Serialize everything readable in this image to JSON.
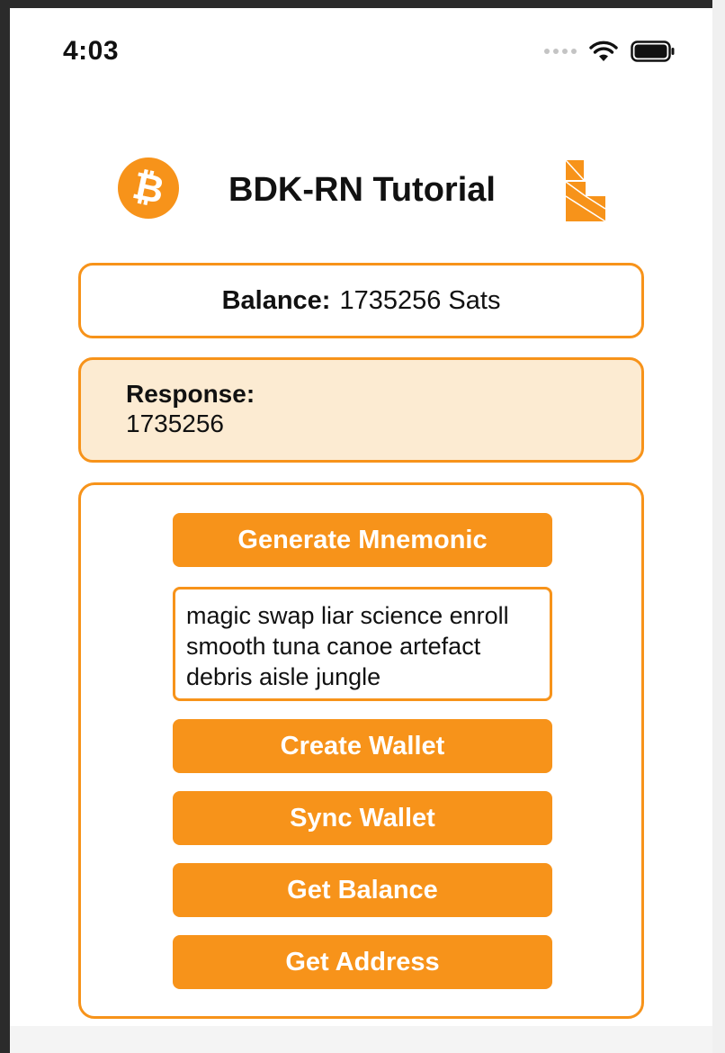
{
  "status_bar": {
    "time": "4:03"
  },
  "header": {
    "title": "BDK-RN Tutorial",
    "left_logo": "bitcoin-logo",
    "right_logo": "bdk-logo"
  },
  "balance": {
    "label": "Balance:",
    "value": "1735256 Sats"
  },
  "response": {
    "label": "Response:",
    "value": "1735256"
  },
  "actions": {
    "generate_mnemonic": "Generate Mnemonic",
    "mnemonic_text": "magic swap liar science enroll smooth tuna canoe artefact debris aisle jungle",
    "create_wallet": "Create Wallet",
    "sync_wallet": "Sync Wallet",
    "get_balance": "Get Balance",
    "get_address": "Get Address"
  },
  "colors": {
    "accent": "#f7931a",
    "response_bg": "#fcebd2"
  }
}
